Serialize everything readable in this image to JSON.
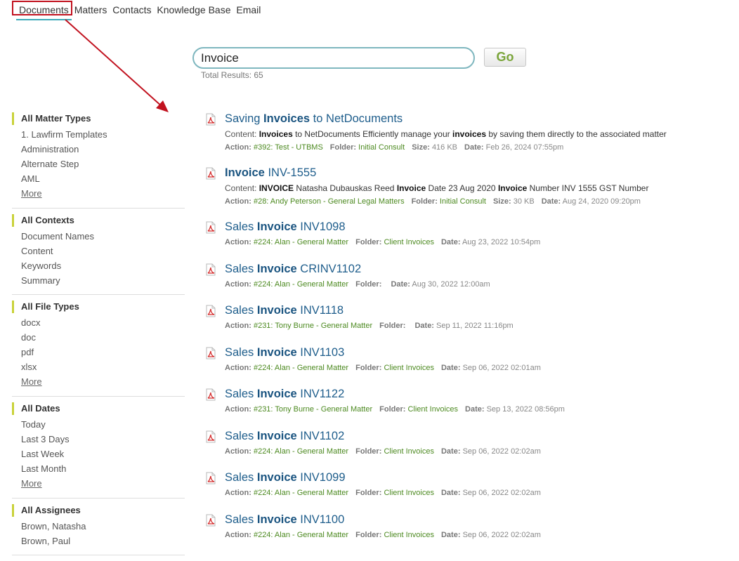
{
  "nav": {
    "items": [
      "Documents",
      "Matters",
      "Contacts",
      "Knowledge Base",
      "Email"
    ],
    "active": "Documents"
  },
  "search": {
    "value": "Invoice",
    "button": "Go",
    "total_results": "Total Results: 65"
  },
  "colors": {
    "accent_teal": "#3ba9b8",
    "annotation_red": "#c1121f",
    "link_green": "#4d8a21",
    "title_blue": "#1f5e8c",
    "facet_bar": "#c9d23a"
  },
  "labels": {
    "content": "Content:",
    "action": "Action:",
    "folder": "Folder:",
    "size": "Size:",
    "date": "Date:"
  },
  "facets": [
    {
      "title": "All Matter Types",
      "items": [
        "1. Lawfirm Templates",
        "Administration",
        "Alternate Step",
        "AML"
      ],
      "more": "More"
    },
    {
      "title": "All Contexts",
      "items": [
        "Document Names",
        "Content",
        "Keywords",
        "Summary"
      ],
      "more": ""
    },
    {
      "title": "All File Types",
      "items": [
        "docx",
        "doc",
        "pdf",
        "xlsx"
      ],
      "more": "More"
    },
    {
      "title": "All Dates",
      "items": [
        "Today",
        "Last 3 Days",
        "Last Week",
        "Last Month"
      ],
      "more": "More"
    },
    {
      "title": "All Assignees",
      "items": [
        "Brown, Natasha",
        "Brown, Paul"
      ],
      "more": ""
    }
  ],
  "results": [
    {
      "title": [
        {
          "t": "Saving ",
          "b": false
        },
        {
          "t": "Invoices",
          "b": true
        },
        {
          "t": " to NetDocuments",
          "b": false
        }
      ],
      "content": [
        {
          "t": "Invoices",
          "b": true
        },
        {
          "t": " to NetDocuments Efficiently manage your ",
          "b": false
        },
        {
          "t": "invoices",
          "b": true
        },
        {
          "t": " by saving them directly to the associated matter",
          "b": false
        }
      ],
      "action": "#392: Test - UTBMS",
      "folder": "Initial Consult",
      "size": "416 KB",
      "date": "Feb 26, 2024 07:55pm"
    },
    {
      "title": [
        {
          "t": "Invoice",
          "b": true
        },
        {
          "t": " INV-1555",
          "b": false
        }
      ],
      "content": [
        {
          "t": "INVOICE",
          "b": true
        },
        {
          "t": " Natasha Dubauskas Reed ",
          "b": false
        },
        {
          "t": "Invoice",
          "b": true
        },
        {
          "t": " Date 23 Aug 2020 ",
          "b": false
        },
        {
          "t": "Invoice",
          "b": true
        },
        {
          "t": " Number INV 1555 GST Number",
          "b": false
        }
      ],
      "action": "#28: Andy Peterson - General Legal Matters",
      "folder": "Initial Consult",
      "size": "30 KB",
      "date": "Aug 24, 2020 09:20pm"
    },
    {
      "title": [
        {
          "t": "Sales ",
          "b": false
        },
        {
          "t": "Invoice",
          "b": true
        },
        {
          "t": " INV1098",
          "b": false
        }
      ],
      "content": null,
      "action": "#224: Alan - General Matter",
      "folder": "Client Invoices",
      "size": null,
      "date": "Aug 23, 2022 10:54pm"
    },
    {
      "title": [
        {
          "t": "Sales ",
          "b": false
        },
        {
          "t": "Invoice",
          "b": true
        },
        {
          "t": " CRINV1102",
          "b": false
        }
      ],
      "content": null,
      "action": "#224: Alan - General Matter",
      "folder": "",
      "size": null,
      "date": "Aug 30, 2022 12:00am"
    },
    {
      "title": [
        {
          "t": "Sales ",
          "b": false
        },
        {
          "t": "Invoice",
          "b": true
        },
        {
          "t": " INV1118",
          "b": false
        }
      ],
      "content": null,
      "action": "#231: Tony Burne - General Matter",
      "folder": "",
      "size": null,
      "date": "Sep 11, 2022 11:16pm"
    },
    {
      "title": [
        {
          "t": "Sales ",
          "b": false
        },
        {
          "t": "Invoice",
          "b": true
        },
        {
          "t": " INV1103",
          "b": false
        }
      ],
      "content": null,
      "action": "#224: Alan - General Matter",
      "folder": "Client Invoices",
      "size": null,
      "date": "Sep 06, 2022 02:01am"
    },
    {
      "title": [
        {
          "t": "Sales ",
          "b": false
        },
        {
          "t": "Invoice",
          "b": true
        },
        {
          "t": " INV1122",
          "b": false
        }
      ],
      "content": null,
      "action": "#231: Tony Burne - General Matter",
      "folder": "Client Invoices",
      "size": null,
      "date": "Sep 13, 2022 08:56pm"
    },
    {
      "title": [
        {
          "t": "Sales ",
          "b": false
        },
        {
          "t": "Invoice",
          "b": true
        },
        {
          "t": " INV1102",
          "b": false
        }
      ],
      "content": null,
      "action": "#224: Alan - General Matter",
      "folder": "Client Invoices",
      "size": null,
      "date": "Sep 06, 2022 02:02am"
    },
    {
      "title": [
        {
          "t": "Sales ",
          "b": false
        },
        {
          "t": "Invoice",
          "b": true
        },
        {
          "t": " INV1099",
          "b": false
        }
      ],
      "content": null,
      "action": "#224: Alan - General Matter",
      "folder": "Client Invoices",
      "size": null,
      "date": "Sep 06, 2022 02:02am"
    },
    {
      "title": [
        {
          "t": "Sales ",
          "b": false
        },
        {
          "t": "Invoice",
          "b": true
        },
        {
          "t": " INV1100",
          "b": false
        }
      ],
      "content": null,
      "action": "#224: Alan - General Matter",
      "folder": "Client Invoices",
      "size": null,
      "date": "Sep 06, 2022 02:02am"
    }
  ]
}
